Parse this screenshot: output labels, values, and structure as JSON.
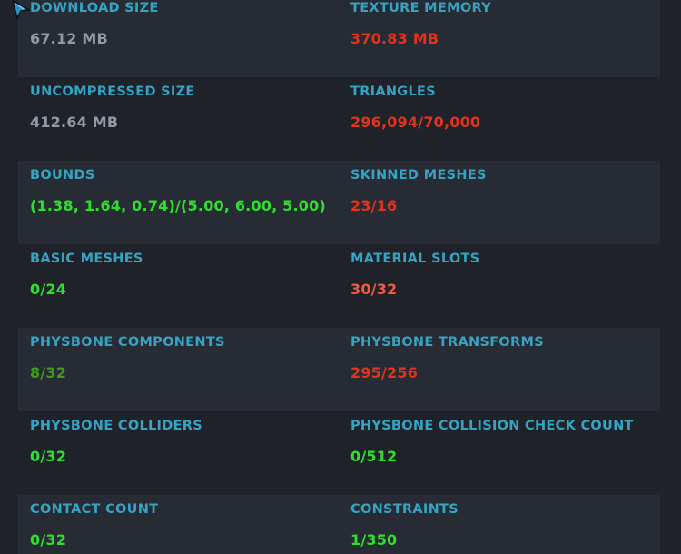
{
  "colors": {
    "label": "#35a3c4",
    "neutral": "#8f9aa3",
    "red": "#e0341c",
    "salmon": "#ef5a44",
    "green": "#2ee02e",
    "dark_green": "#3e9a1c",
    "row_shade": "#272b34",
    "background": "#1f2228"
  },
  "cursor_icon": "pointer-arrow-icon",
  "stats": [
    {
      "left": {
        "label": "DOWNLOAD SIZE",
        "value": "67.12 MB",
        "color": "#8f9aa3"
      },
      "right": {
        "label": "TEXTURE MEMORY",
        "value": "370.83 MB",
        "color": "#e0341c"
      }
    },
    {
      "left": {
        "label": "UNCOMPRESSED SIZE",
        "value": "412.64 MB",
        "color": "#8f9aa3"
      },
      "right": {
        "label": "TRIANGLES",
        "value": "296,094/70,000",
        "color": "#e0341c"
      }
    },
    {
      "left": {
        "label": "BOUNDS",
        "value": "(1.38, 1.64, 0.74)/(5.00, 6.00, 5.00)",
        "color": "#2ee02e"
      },
      "right": {
        "label": "SKINNED MESHES",
        "value": "23/16",
        "color": "#e0341c"
      }
    },
    {
      "left": {
        "label": "BASIC MESHES",
        "value": "0/24",
        "color": "#2ee02e"
      },
      "right": {
        "label": "MATERIAL SLOTS",
        "value": "30/32",
        "color": "#ef5a44"
      }
    },
    {
      "left": {
        "label": "PHYSBONE COMPONENTS",
        "value": "8/32",
        "color": "#3e9a1c"
      },
      "right": {
        "label": "PHYSBONE TRANSFORMS",
        "value": "295/256",
        "color": "#e0341c"
      }
    },
    {
      "left": {
        "label": "PHYSBONE COLLIDERS",
        "value": "0/32",
        "color": "#2ee02e"
      },
      "right": {
        "label": "PHYSBONE COLLISION CHECK COUNT",
        "value": "0/512",
        "color": "#2ee02e"
      }
    },
    {
      "left": {
        "label": "CONTACT COUNT",
        "value": "0/32",
        "color": "#2ee02e"
      },
      "right": {
        "label": "CONSTRAINTS",
        "value": "1/350",
        "color": "#2ee02e"
      }
    }
  ]
}
